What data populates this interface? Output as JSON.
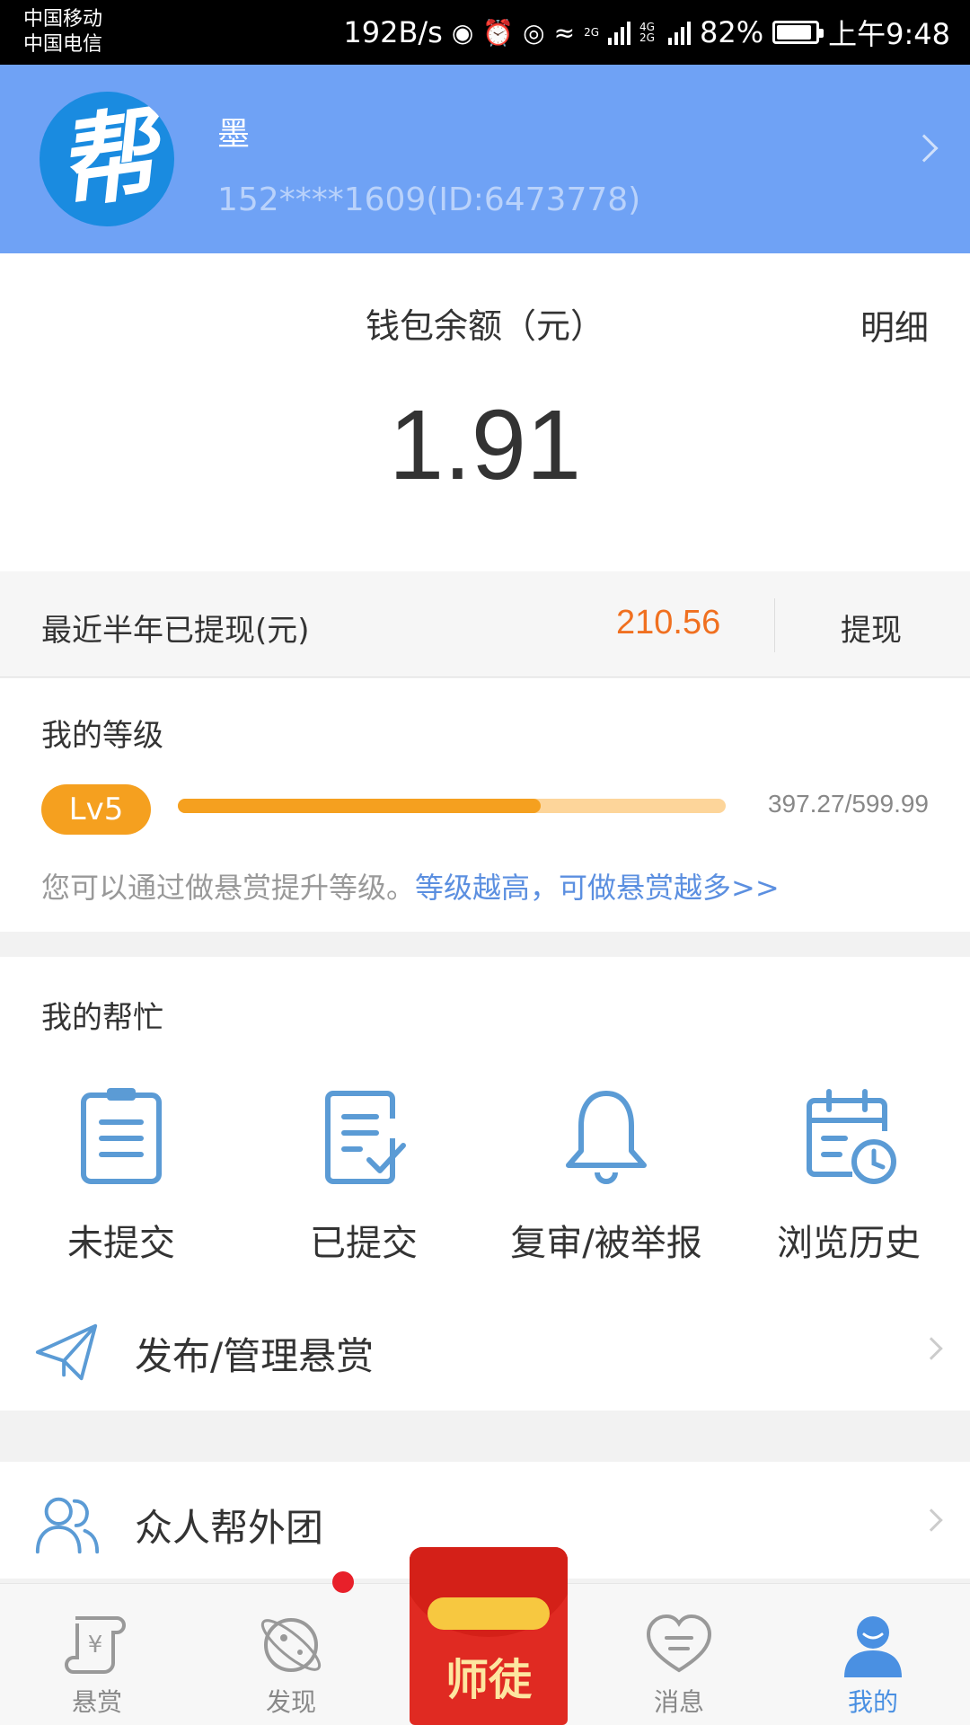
{
  "status_bar": {
    "carrier1": "中国移动",
    "carrier2": "中国电信",
    "speed": "192B/s",
    "net1": "2G",
    "net2": "4G 2G",
    "battery": "82%",
    "time": "上午9:48"
  },
  "profile": {
    "avatar_text": "帮",
    "nickname": "墨",
    "account": "152****1609(ID:6473778)"
  },
  "wallet": {
    "title": "钱包余额（元）",
    "detail_label": "明细",
    "balance": "1.91"
  },
  "withdraw": {
    "label": "最近半年已提现(元)",
    "amount": "210.56",
    "button": "提现"
  },
  "level": {
    "title": "我的等级",
    "badge": "Lv5",
    "progress_text": "397.27/599.99",
    "progress_fraction": 0.662,
    "hint": "您可以通过做悬赏提升等级。",
    "hint_link": "等级越高，可做悬赏越多>>"
  },
  "my_help": {
    "title": "我的帮忙",
    "items": [
      {
        "label": "未提交",
        "icon": "clipboard-icon"
      },
      {
        "label": "已提交",
        "icon": "document-check-icon"
      },
      {
        "label": "复审/被举报",
        "icon": "bell-icon"
      },
      {
        "label": "浏览历史",
        "icon": "calendar-clock-icon"
      }
    ]
  },
  "rows": {
    "publish": "发布/管理悬赏",
    "team": "众人帮外团"
  },
  "bottom_nav": {
    "items": [
      {
        "label": "悬赏",
        "icon": "scroll-yen-icon"
      },
      {
        "label": "发现",
        "icon": "planet-icon"
      },
      {
        "label": "师徒",
        "icon": "red-packet-icon"
      },
      {
        "label": "消息",
        "icon": "chat-heart-icon"
      },
      {
        "label": "我的",
        "icon": "user-icon"
      }
    ]
  },
  "colors": {
    "header_bg": "#6fa2f5",
    "accent_orange": "#f5a01f",
    "amount_orange": "#f07020",
    "icon_blue": "#5b9bd5",
    "active_blue": "#4a90e2"
  }
}
